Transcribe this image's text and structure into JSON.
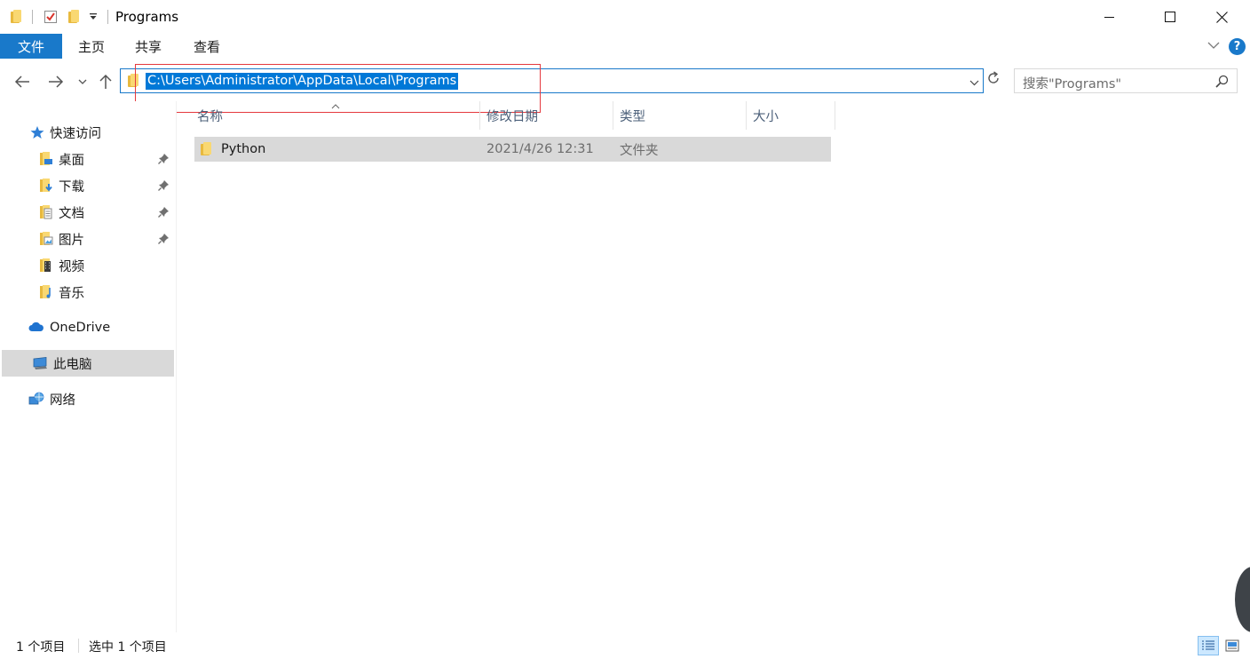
{
  "window": {
    "title": "Programs",
    "minimize_icon": "minimize-icon",
    "maximize_icon": "maximize-icon",
    "close_icon": "close-icon"
  },
  "ribbon": {
    "tabs": [
      {
        "label": "文件",
        "active": true
      },
      {
        "label": "主页"
      },
      {
        "label": "共享"
      },
      {
        "label": "查看"
      }
    ],
    "accent": "#1979ca"
  },
  "address": {
    "path": "C:\\Users\\Administrator\\AppData\\Local\\Programs",
    "selection_color": "#0078d7"
  },
  "search": {
    "placeholder": "搜索\"Programs\""
  },
  "sidebar": {
    "quick_access": "快速访问",
    "items": [
      {
        "label": "桌面",
        "icon": "desktop-folder-icon",
        "pinned": true
      },
      {
        "label": "下载",
        "icon": "downloads-folder-icon",
        "pinned": true
      },
      {
        "label": "文档",
        "icon": "documents-folder-icon",
        "pinned": true
      },
      {
        "label": "图片",
        "icon": "pictures-folder-icon",
        "pinned": true
      },
      {
        "label": "视频",
        "icon": "videos-folder-icon",
        "pinned": false
      },
      {
        "label": "音乐",
        "icon": "music-folder-icon",
        "pinned": false
      }
    ],
    "onedrive": "OneDrive",
    "this_pc": "此电脑",
    "network": "网络"
  },
  "columns": {
    "name": "名称",
    "modified": "修改日期",
    "type": "类型",
    "size": "大小"
  },
  "files": [
    {
      "name": "Python",
      "modified": "2021/4/26 12:31",
      "type": "文件夹",
      "size": ""
    }
  ],
  "status": {
    "count": "1 个项目",
    "selected": "选中 1 个项目"
  }
}
